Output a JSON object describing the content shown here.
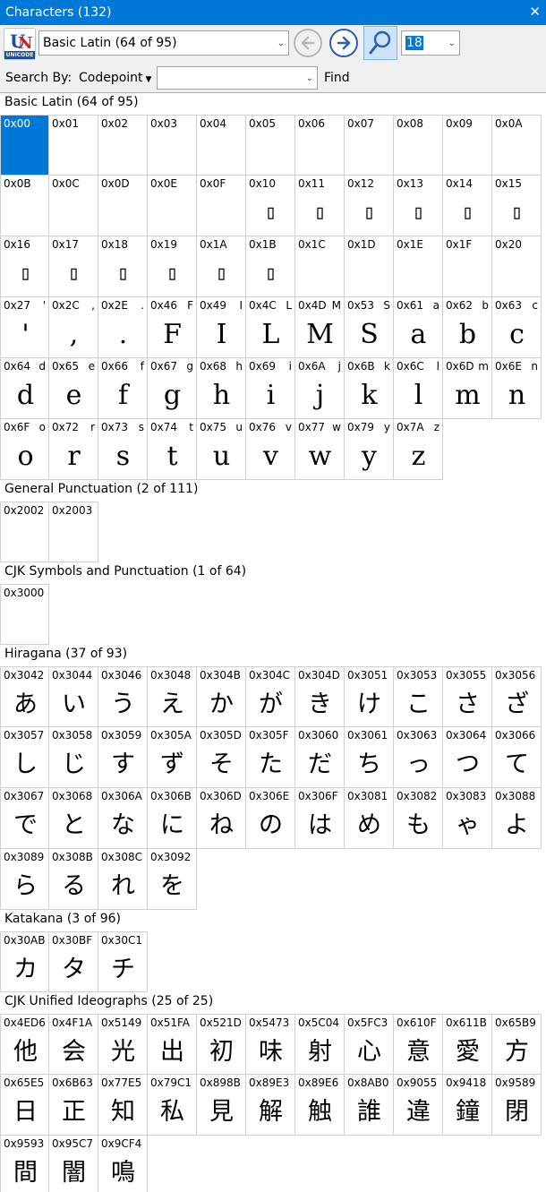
{
  "window": {
    "title": "Characters (132)",
    "close_glyph": "✕"
  },
  "toolbar": {
    "logo_icon": "unicode-logo-icon",
    "logo_caption": "UNICODE",
    "block_select": "Basic Latin (64 of 95)",
    "font_size": "18",
    "back_icon": "arrow-left-icon",
    "forward_icon": "arrow-right-icon",
    "search_icon": "magnifier-icon"
  },
  "search": {
    "label": "Search By:",
    "mode": "Codepoint",
    "query": "",
    "find_label": "Find"
  },
  "sections": [
    {
      "title": "Basic Latin (64 of 95)",
      "cells": [
        {
          "code": "0x00",
          "small": "",
          "glyph": "",
          "selected": true
        },
        {
          "code": "0x01",
          "small": "",
          "glyph": ""
        },
        {
          "code": "0x02",
          "small": "",
          "glyph": ""
        },
        {
          "code": "0x03",
          "small": "",
          "glyph": ""
        },
        {
          "code": "0x04",
          "small": "",
          "glyph": ""
        },
        {
          "code": "0x05",
          "small": "",
          "glyph": ""
        },
        {
          "code": "0x06",
          "small": "",
          "glyph": ""
        },
        {
          "code": "0x07",
          "small": "",
          "glyph": ""
        },
        {
          "code": "0x08",
          "small": "",
          "glyph": ""
        },
        {
          "code": "0x09",
          "small": "",
          "glyph": ""
        },
        {
          "code": "0x0A",
          "small": "",
          "glyph": ""
        },
        {
          "code": "0x0B",
          "small": "",
          "glyph": ""
        },
        {
          "code": "0x0C",
          "small": "",
          "glyph": ""
        },
        {
          "code": "0x0D",
          "small": "",
          "glyph": ""
        },
        {
          "code": "0x0E",
          "small": "",
          "glyph": ""
        },
        {
          "code": "0x0F",
          "small": "",
          "glyph": ""
        },
        {
          "code": "0x10",
          "small": "",
          "glyph": "▯",
          "box": true
        },
        {
          "code": "0x11",
          "small": "",
          "glyph": "▯",
          "box": true
        },
        {
          "code": "0x12",
          "small": "",
          "glyph": "▯",
          "box": true
        },
        {
          "code": "0x13",
          "small": "",
          "glyph": "▯",
          "box": true
        },
        {
          "code": "0x14",
          "small": "",
          "glyph": "▯",
          "box": true
        },
        {
          "code": "0x15",
          "small": "",
          "glyph": "▯",
          "box": true
        },
        {
          "code": "0x16",
          "small": "",
          "glyph": "▯",
          "box": true
        },
        {
          "code": "0x17",
          "small": "",
          "glyph": "▯",
          "box": true
        },
        {
          "code": "0x18",
          "small": "",
          "glyph": "▯",
          "box": true
        },
        {
          "code": "0x19",
          "small": "",
          "glyph": "▯",
          "box": true
        },
        {
          "code": "0x1A",
          "small": "",
          "glyph": "▯",
          "box": true
        },
        {
          "code": "0x1B",
          "small": "",
          "glyph": "▯",
          "box": true
        },
        {
          "code": "0x1C",
          "small": "",
          "glyph": ""
        },
        {
          "code": "0x1D",
          "small": "",
          "glyph": ""
        },
        {
          "code": "0x1E",
          "small": "",
          "glyph": ""
        },
        {
          "code": "0x1F",
          "small": "",
          "glyph": ""
        },
        {
          "code": "0x20",
          "small": "",
          "glyph": ""
        },
        {
          "code": "0x27",
          "small": "'",
          "glyph": "'"
        },
        {
          "code": "0x2C",
          "small": ",",
          "glyph": ","
        },
        {
          "code": "0x2E",
          "small": ".",
          "glyph": "."
        },
        {
          "code": "0x46",
          "small": "F",
          "glyph": "F"
        },
        {
          "code": "0x49",
          "small": "I",
          "glyph": "I"
        },
        {
          "code": "0x4C",
          "small": "L",
          "glyph": "L"
        },
        {
          "code": "0x4D",
          "small": "M",
          "glyph": "M"
        },
        {
          "code": "0x53",
          "small": "S",
          "glyph": "S"
        },
        {
          "code": "0x61",
          "small": "a",
          "glyph": "a"
        },
        {
          "code": "0x62",
          "small": "b",
          "glyph": "b"
        },
        {
          "code": "0x63",
          "small": "c",
          "glyph": "c"
        },
        {
          "code": "0x64",
          "small": "d",
          "glyph": "d"
        },
        {
          "code": "0x65",
          "small": "e",
          "glyph": "e"
        },
        {
          "code": "0x66",
          "small": "f",
          "glyph": "f"
        },
        {
          "code": "0x67",
          "small": "g",
          "glyph": "g"
        },
        {
          "code": "0x68",
          "small": "h",
          "glyph": "h"
        },
        {
          "code": "0x69",
          "small": "i",
          "glyph": "i"
        },
        {
          "code": "0x6A",
          "small": "j",
          "glyph": "j"
        },
        {
          "code": "0x6B",
          "small": "k",
          "glyph": "k"
        },
        {
          "code": "0x6C",
          "small": "l",
          "glyph": "l"
        },
        {
          "code": "0x6D",
          "small": "m",
          "glyph": "m"
        },
        {
          "code": "0x6E",
          "small": "n",
          "glyph": "n"
        },
        {
          "code": "0x6F",
          "small": "o",
          "glyph": "o"
        },
        {
          "code": "0x72",
          "small": "r",
          "glyph": "r"
        },
        {
          "code": "0x73",
          "small": "s",
          "glyph": "s"
        },
        {
          "code": "0x74",
          "small": "t",
          "glyph": "t"
        },
        {
          "code": "0x75",
          "small": "u",
          "glyph": "u"
        },
        {
          "code": "0x76",
          "small": "v",
          "glyph": "v"
        },
        {
          "code": "0x77",
          "small": "w",
          "glyph": "w"
        },
        {
          "code": "0x79",
          "small": "y",
          "glyph": "y"
        },
        {
          "code": "0x7A",
          "small": "z",
          "glyph": "z"
        }
      ]
    },
    {
      "title": "General Punctuation (2 of 111)",
      "cells": [
        {
          "code": "0x2002",
          "small": "",
          "glyph": ""
        },
        {
          "code": "0x2003",
          "small": "",
          "glyph": ""
        }
      ]
    },
    {
      "title": "CJK Symbols and Punctuation (1 of 64)",
      "cells": [
        {
          "code": "0x3000",
          "small": "",
          "glyph": ""
        }
      ]
    },
    {
      "title": "Hiragana (37 of 93)",
      "cells": [
        {
          "code": "0x3042",
          "small": "",
          "glyph": "あ",
          "cjk": true
        },
        {
          "code": "0x3044",
          "small": "",
          "glyph": "い",
          "cjk": true
        },
        {
          "code": "0x3046",
          "small": "",
          "glyph": "う",
          "cjk": true
        },
        {
          "code": "0x3048",
          "small": "",
          "glyph": "え",
          "cjk": true
        },
        {
          "code": "0x304B",
          "small": "",
          "glyph": "か",
          "cjk": true
        },
        {
          "code": "0x304C",
          "small": "",
          "glyph": "が",
          "cjk": true
        },
        {
          "code": "0x304D",
          "small": "",
          "glyph": "き",
          "cjk": true
        },
        {
          "code": "0x3051",
          "small": "",
          "glyph": "け",
          "cjk": true
        },
        {
          "code": "0x3053",
          "small": "",
          "glyph": "こ",
          "cjk": true
        },
        {
          "code": "0x3055",
          "small": "",
          "glyph": "さ",
          "cjk": true
        },
        {
          "code": "0x3056",
          "small": "",
          "glyph": "ざ",
          "cjk": true
        },
        {
          "code": "0x3057",
          "small": "",
          "glyph": "し",
          "cjk": true
        },
        {
          "code": "0x3058",
          "small": "",
          "glyph": "じ",
          "cjk": true
        },
        {
          "code": "0x3059",
          "small": "",
          "glyph": "す",
          "cjk": true
        },
        {
          "code": "0x305A",
          "small": "",
          "glyph": "ず",
          "cjk": true
        },
        {
          "code": "0x305D",
          "small": "",
          "glyph": "そ",
          "cjk": true
        },
        {
          "code": "0x305F",
          "small": "",
          "glyph": "た",
          "cjk": true
        },
        {
          "code": "0x3060",
          "small": "",
          "glyph": "だ",
          "cjk": true
        },
        {
          "code": "0x3061",
          "small": "",
          "glyph": "ち",
          "cjk": true
        },
        {
          "code": "0x3063",
          "small": "",
          "glyph": "っ",
          "cjk": true
        },
        {
          "code": "0x3064",
          "small": "",
          "glyph": "つ",
          "cjk": true
        },
        {
          "code": "0x3066",
          "small": "",
          "glyph": "て",
          "cjk": true
        },
        {
          "code": "0x3067",
          "small": "",
          "glyph": "で",
          "cjk": true
        },
        {
          "code": "0x3068",
          "small": "",
          "glyph": "と",
          "cjk": true
        },
        {
          "code": "0x306A",
          "small": "",
          "glyph": "な",
          "cjk": true
        },
        {
          "code": "0x306B",
          "small": "",
          "glyph": "に",
          "cjk": true
        },
        {
          "code": "0x306D",
          "small": "",
          "glyph": "ね",
          "cjk": true
        },
        {
          "code": "0x306E",
          "small": "",
          "glyph": "の",
          "cjk": true
        },
        {
          "code": "0x306F",
          "small": "",
          "glyph": "は",
          "cjk": true
        },
        {
          "code": "0x3081",
          "small": "",
          "glyph": "め",
          "cjk": true
        },
        {
          "code": "0x3082",
          "small": "",
          "glyph": "も",
          "cjk": true
        },
        {
          "code": "0x3083",
          "small": "",
          "glyph": "ゃ",
          "cjk": true
        },
        {
          "code": "0x3088",
          "small": "",
          "glyph": "よ",
          "cjk": true
        },
        {
          "code": "0x3089",
          "small": "",
          "glyph": "ら",
          "cjk": true
        },
        {
          "code": "0x308B",
          "small": "",
          "glyph": "る",
          "cjk": true
        },
        {
          "code": "0x308C",
          "small": "",
          "glyph": "れ",
          "cjk": true
        },
        {
          "code": "0x3092",
          "small": "",
          "glyph": "を",
          "cjk": true
        }
      ]
    },
    {
      "title": "Katakana (3 of 96)",
      "cells": [
        {
          "code": "0x30AB",
          "small": "",
          "glyph": "カ",
          "cjk": true
        },
        {
          "code": "0x30BF",
          "small": "",
          "glyph": "タ",
          "cjk": true
        },
        {
          "code": "0x30C1",
          "small": "",
          "glyph": "チ",
          "cjk": true
        }
      ]
    },
    {
      "title": "CJK Unified Ideographs (25 of 25)",
      "cells": [
        {
          "code": "0x4ED6",
          "small": "",
          "glyph": "他",
          "cjk": true
        },
        {
          "code": "0x4F1A",
          "small": "",
          "glyph": "会",
          "cjk": true
        },
        {
          "code": "0x5149",
          "small": "",
          "glyph": "光",
          "cjk": true
        },
        {
          "code": "0x51FA",
          "small": "",
          "glyph": "出",
          "cjk": true
        },
        {
          "code": "0x521D",
          "small": "",
          "glyph": "初",
          "cjk": true
        },
        {
          "code": "0x5473",
          "small": "",
          "glyph": "味",
          "cjk": true
        },
        {
          "code": "0x5C04",
          "small": "",
          "glyph": "射",
          "cjk": true
        },
        {
          "code": "0x5FC3",
          "small": "",
          "glyph": "心",
          "cjk": true
        },
        {
          "code": "0x610F",
          "small": "",
          "glyph": "意",
          "cjk": true
        },
        {
          "code": "0x611B",
          "small": "",
          "glyph": "愛",
          "cjk": true
        },
        {
          "code": "0x65B9",
          "small": "",
          "glyph": "方",
          "cjk": true
        },
        {
          "code": "0x65E5",
          "small": "",
          "glyph": "日",
          "cjk": true
        },
        {
          "code": "0x6B63",
          "small": "",
          "glyph": "正",
          "cjk": true
        },
        {
          "code": "0x77E5",
          "small": "",
          "glyph": "知",
          "cjk": true
        },
        {
          "code": "0x79C1",
          "small": "",
          "glyph": "私",
          "cjk": true
        },
        {
          "code": "0x898B",
          "small": "",
          "glyph": "見",
          "cjk": true
        },
        {
          "code": "0x89E3",
          "small": "",
          "glyph": "解",
          "cjk": true
        },
        {
          "code": "0x89E6",
          "small": "",
          "glyph": "触",
          "cjk": true
        },
        {
          "code": "0x8AB0",
          "small": "",
          "glyph": "誰",
          "cjk": true
        },
        {
          "code": "0x9055",
          "small": "",
          "glyph": "違",
          "cjk": true
        },
        {
          "code": "0x9418",
          "small": "",
          "glyph": "鐘",
          "cjk": true
        },
        {
          "code": "0x9589",
          "small": "",
          "glyph": "閉",
          "cjk": true
        },
        {
          "code": "0x9593",
          "small": "",
          "glyph": "間",
          "cjk": true
        },
        {
          "code": "0x95C7",
          "small": "",
          "glyph": "闇",
          "cjk": true
        },
        {
          "code": "0x9CF4",
          "small": "",
          "glyph": "鳴",
          "cjk": true
        }
      ]
    }
  ]
}
